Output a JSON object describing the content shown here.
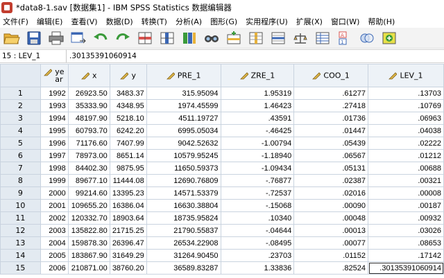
{
  "window": {
    "title": "*data8-1.sav [数据集1] - IBM SPSS Statistics 数据编辑器"
  },
  "menu": [
    "文件(F)",
    "编辑(E)",
    "查看(V)",
    "数据(D)",
    "转换(T)",
    "分析(A)",
    "图形(G)",
    "实用程序(U)",
    "扩展(X)",
    "窗口(W)",
    "帮助(H)"
  ],
  "toolbar": {
    "buttons": [
      "open-icon",
      "save-icon",
      "print-icon",
      "dialog-recall-icon",
      "undo-icon",
      "redo-icon",
      "goto-case-icon",
      "goto-variable-icon",
      "variables-icon",
      "find-icon",
      "insert-cases-icon",
      "insert-variable-icon",
      "split-file-icon",
      "weight-cases-icon",
      "select-cases-icon",
      "value-labels-icon",
      "use-variable-sets-icon",
      "spelling-icon"
    ]
  },
  "cellbar": {
    "ref": "15 : LEV_1",
    "value": ".30135391060914"
  },
  "columns": [
    "year",
    "x",
    "y",
    "PRE_1",
    "ZRE_1",
    "COO_1",
    "LEV_1"
  ],
  "rows": [
    {
      "num": "1",
      "cells": [
        "1992",
        "26923.50",
        "3483.37",
        "315.95094",
        "1.95319",
        ".61277",
        ".13703"
      ]
    },
    {
      "num": "2",
      "cells": [
        "1993",
        "35333.90",
        "4348.95",
        "1974.45599",
        "1.46423",
        ".27418",
        ".10769"
      ]
    },
    {
      "num": "3",
      "cells": [
        "1994",
        "48197.90",
        "5218.10",
        "4511.19727",
        ".43591",
        ".01736",
        ".06963"
      ]
    },
    {
      "num": "4",
      "cells": [
        "1995",
        "60793.70",
        "6242.20",
        "6995.05034",
        "-.46425",
        ".01447",
        ".04038"
      ]
    },
    {
      "num": "5",
      "cells": [
        "1996",
        "71176.60",
        "7407.99",
        "9042.52632",
        "-1.00794",
        ".05439",
        ".02222"
      ]
    },
    {
      "num": "6",
      "cells": [
        "1997",
        "78973.00",
        "8651.14",
        "10579.95245",
        "-1.18940",
        ".06567",
        ".01212"
      ]
    },
    {
      "num": "7",
      "cells": [
        "1998",
        "84402.30",
        "9875.95",
        "11650.59373",
        "-1.09434",
        ".05131",
        ".00688"
      ]
    },
    {
      "num": "8",
      "cells": [
        "1999",
        "89677.10",
        "11444.08",
        "12690.76809",
        "-.76877",
        ".02387",
        ".00321"
      ]
    },
    {
      "num": "9",
      "cells": [
        "2000",
        "99214.60",
        "13395.23",
        "14571.53379",
        "-.72537",
        ".02016",
        ".00008"
      ]
    },
    {
      "num": "10",
      "cells": [
        "2001",
        "109655.20",
        "16386.04",
        "16630.38804",
        "-.15068",
        ".00090",
        ".00187"
      ]
    },
    {
      "num": "11",
      "cells": [
        "2002",
        "120332.70",
        "18903.64",
        "18735.95824",
        ".10340",
        ".00048",
        ".00932"
      ]
    },
    {
      "num": "12",
      "cells": [
        "2003",
        "135822.80",
        "21715.25",
        "21790.55837",
        "-.04644",
        ".00013",
        ".03026"
      ]
    },
    {
      "num": "13",
      "cells": [
        "2004",
        "159878.30",
        "26396.47",
        "26534.22908",
        "-.08495",
        ".00077",
        ".08653"
      ]
    },
    {
      "num": "14",
      "cells": [
        "2005",
        "183867.90",
        "31649.29",
        "31264.90450",
        ".23703",
        ".01152",
        ".17142"
      ]
    },
    {
      "num": "15",
      "cells": [
        "2006",
        "210871.00",
        "38760.20",
        "36589.83287",
        "1.33836",
        ".82524",
        ".30135391060914"
      ]
    }
  ]
}
